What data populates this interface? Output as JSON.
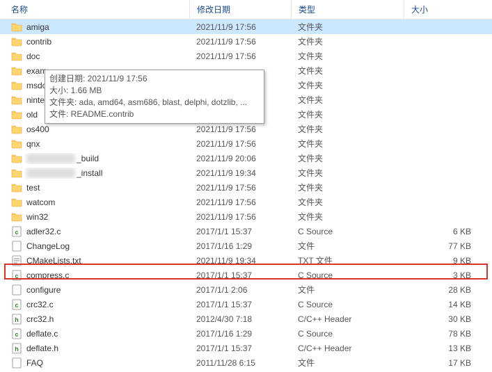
{
  "columns": {
    "name": "名称",
    "date": "修改日期",
    "type": "类型",
    "size": "大小"
  },
  "rows": [
    {
      "icon": "folder",
      "name": "amiga",
      "date": "2021/11/9 17:56",
      "type": "文件夹",
      "size": "",
      "selected": true
    },
    {
      "icon": "folder",
      "name": "contrib",
      "date": "2021/11/9 17:56",
      "type": "文件夹",
      "size": ""
    },
    {
      "icon": "folder",
      "name": "doc",
      "date": "2021/11/9 17:56",
      "type": "文件夹",
      "size": ""
    },
    {
      "icon": "folder",
      "name": "exam",
      "blurAfter": false,
      "date": "",
      "type": "文件夹",
      "size": ""
    },
    {
      "icon": "folder",
      "name": "msdo",
      "blurAfter": false,
      "date": "",
      "type": "文件夹",
      "size": ""
    },
    {
      "icon": "folder",
      "name": "ninte",
      "blurAfter": false,
      "date": "",
      "type": "文件夹",
      "size": ""
    },
    {
      "icon": "folder",
      "name": "old",
      "date": "2021/11/9 17:56",
      "type": "文件夹",
      "size": ""
    },
    {
      "icon": "folder",
      "name": "os400",
      "date": "2021/11/9 17:56",
      "type": "文件夹",
      "size": ""
    },
    {
      "icon": "folder",
      "name": "qnx",
      "date": "2021/11/9 17:56",
      "type": "文件夹",
      "size": ""
    },
    {
      "icon": "folder",
      "name": "_build",
      "blurBefore": 70,
      "date": "2021/11/9 20:06",
      "type": "文件夹",
      "size": ""
    },
    {
      "icon": "folder",
      "name": "_install",
      "blurBefore": 70,
      "date": "2021/11/9 19:34",
      "type": "文件夹",
      "size": ""
    },
    {
      "icon": "folder",
      "name": "test",
      "date": "2021/11/9 17:56",
      "type": "文件夹",
      "size": ""
    },
    {
      "icon": "folder",
      "name": "watcom",
      "date": "2021/11/9 17:56",
      "type": "文件夹",
      "size": ""
    },
    {
      "icon": "folder",
      "name": "win32",
      "date": "2021/11/9 17:56",
      "type": "文件夹",
      "size": ""
    },
    {
      "icon": "file-c",
      "name": "adler32.c",
      "date": "2017/1/1 15:37",
      "type": "C Source",
      "size": "6 KB"
    },
    {
      "icon": "file",
      "name": "ChangeLog",
      "date": "2017/1/16 1:29",
      "type": "文件",
      "size": "77 KB"
    },
    {
      "icon": "file-txt",
      "name": "CMakeLists.txt",
      "date": "2021/11/9 19:34",
      "type": "TXT 文件",
      "size": "9 KB"
    },
    {
      "icon": "file-c",
      "name": "compress.c",
      "date": "2017/1/1 15:37",
      "type": "C Source",
      "size": "3 KB"
    },
    {
      "icon": "file",
      "name": "configure",
      "date": "2017/1/1 2:06",
      "type": "文件",
      "size": "28 KB"
    },
    {
      "icon": "file-c",
      "name": "crc32.c",
      "date": "2017/1/1 15:37",
      "type": "C Source",
      "size": "14 KB"
    },
    {
      "icon": "file-h",
      "name": "crc32.h",
      "date": "2012/4/30 7:18",
      "type": "C/C++ Header",
      "size": "30 KB"
    },
    {
      "icon": "file-c",
      "name": "deflate.c",
      "date": "2017/1/16 1:29",
      "type": "C Source",
      "size": "78 KB"
    },
    {
      "icon": "file-h",
      "name": "deflate.h",
      "date": "2017/1/1 15:37",
      "type": "C/C++ Header",
      "size": "13 KB"
    },
    {
      "icon": "file",
      "name": "FAQ",
      "date": "2011/11/28 6:15",
      "type": "文件",
      "size": "17 KB"
    }
  ],
  "tooltip": {
    "line1": "创建日期: 2021/11/9 17:56",
    "line2": "大小: 1.66 MB",
    "line3": "文件夹: ada, amd64, asm686, blast, delphi, dotzlib, ...",
    "line4": "文件: README.contrib"
  }
}
